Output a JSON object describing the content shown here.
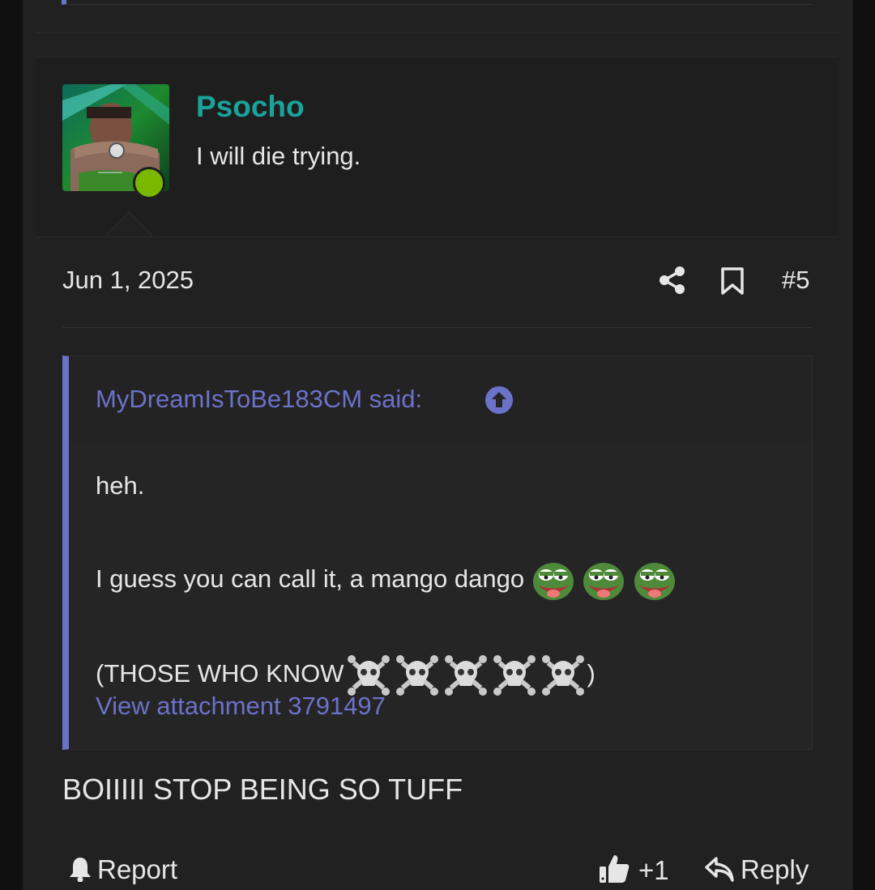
{
  "post": {
    "username": "Psocho",
    "user_title": "I will die trying.",
    "date": "Jun 1, 2025",
    "number": "#5",
    "body": "BOIIIII STOP BEING SO TUFF"
  },
  "quote": {
    "author_said": "MyDreamIsToBe183CM said:",
    "line1": "heh.",
    "line2": "I guess you can call it, a mango dango",
    "line3_open": "(THOSE WHO KNOW",
    "line3_close": ")",
    "attachment_link": "View attachment 3791497"
  },
  "actions": {
    "report": "Report",
    "like_count": "+1",
    "reply": "Reply"
  },
  "colors": {
    "accent": "#6b72c9",
    "username": "#1aa39a",
    "online": "#7ab800"
  },
  "icons": [
    "share-icon",
    "bookmark-icon",
    "arrow-up-circle-icon",
    "bell-icon",
    "thumbs-up-icon",
    "reply-icon",
    "pepe-emoji",
    "skull-crossbones-emoji"
  ]
}
